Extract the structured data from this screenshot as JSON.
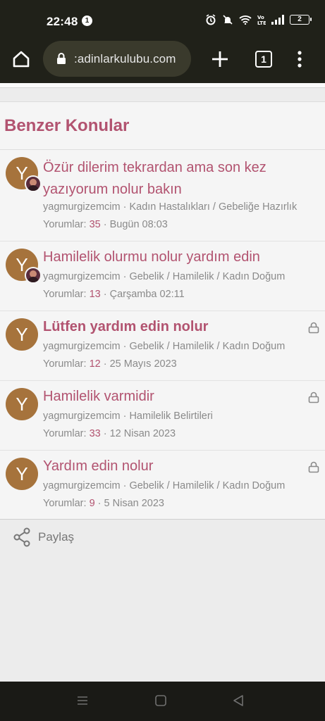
{
  "status_bar": {
    "time": "22:48",
    "notification_count": "1",
    "battery": "2",
    "icons": [
      "alarm-icon",
      "mute-icon",
      "wifi-icon",
      "volte-icon",
      "signal-icon",
      "battery-icon"
    ]
  },
  "browser": {
    "url": ":adinlarkulubu.com",
    "tab_count": "1",
    "icons": [
      "home-icon",
      "lock-icon",
      "plus-icon",
      "tabs-icon",
      "more-vert-icon"
    ]
  },
  "similar": {
    "title": "Benzer Konular",
    "threads": [
      {
        "avatar_letter": "Y",
        "title": "Özür dilerim tekrardan ama son kez yazıyorum nolur bakın",
        "meta": "yagmurgizemcim · Kadın Hastalıkları / Gebeliğe Hazırlık",
        "replies_label": "Yorumlar:",
        "replies": "35",
        "date": "· Bugün 08:03",
        "locked": false,
        "has_mini_avatar": true,
        "bold": false
      },
      {
        "avatar_letter": "Y",
        "title": "Hamilelik olurmu nolur yardım edin",
        "meta": "yagmurgizemcim · Gebelik / Hamilelik / Kadın Doğum",
        "replies_label": "Yorumlar:",
        "replies": "13",
        "date": "· Çarşamba 02:11",
        "locked": false,
        "has_mini_avatar": true,
        "bold": false
      },
      {
        "avatar_letter": "Y",
        "title": "Lütfen yardım edin nolur",
        "meta": "yagmurgizemcim · Gebelik / Hamilelik / Kadın Doğum",
        "replies_label": "Yorumlar:",
        "replies": "12",
        "date": "· 25 Mayıs 2023",
        "locked": true,
        "has_mini_avatar": false,
        "bold": true
      },
      {
        "avatar_letter": "Y",
        "title": "Hamilelik varmidir",
        "meta": "yagmurgizemcim · Hamilelik Belirtileri",
        "replies_label": "Yorumlar:",
        "replies": "33",
        "date": "· 12 Nisan 2023",
        "locked": true,
        "has_mini_avatar": false,
        "bold": false
      },
      {
        "avatar_letter": "Y",
        "title": "Yardım edin nolur",
        "meta": "yagmurgizemcim · Gebelik / Hamilelik / Kadın Doğum",
        "replies_label": "Yorumlar:",
        "replies": "9",
        "date": "· 5 Nisan 2023",
        "locked": true,
        "has_mini_avatar": false,
        "bold": false
      }
    ]
  },
  "share": {
    "label": "Paylaş",
    "icon": "share-icon"
  },
  "nav_bar": {
    "icons": [
      "recents-icon",
      "home-nav-icon",
      "back-icon"
    ]
  },
  "colors": {
    "accent": "#b25370",
    "avatar": "#a6733c",
    "chrome": "#202119"
  }
}
